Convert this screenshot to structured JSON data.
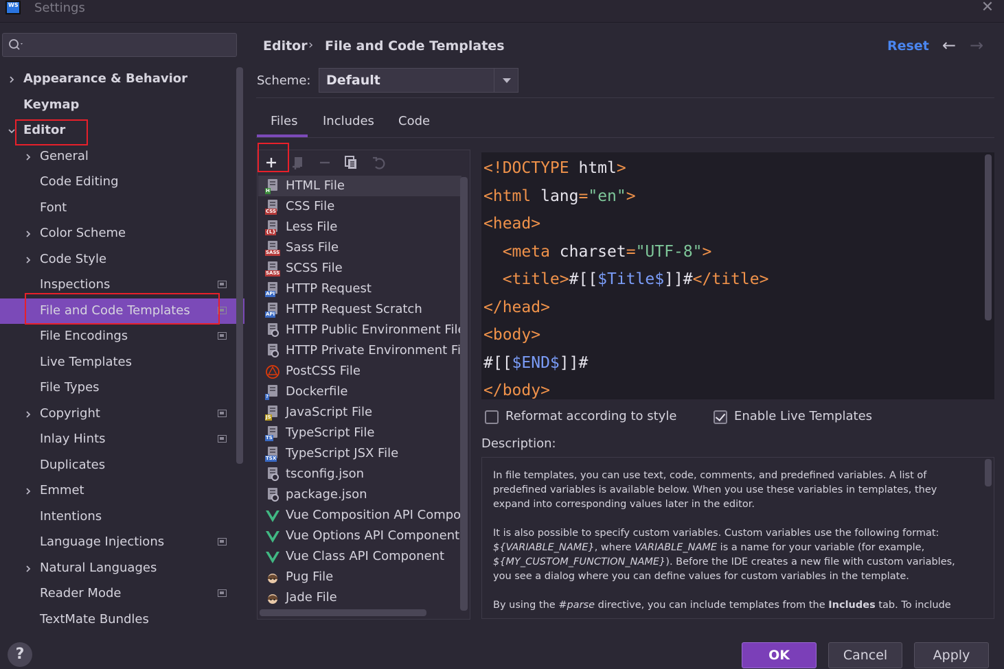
{
  "window": {
    "title": "Settings",
    "logo_text": "WS"
  },
  "search": {
    "placeholder": ""
  },
  "sidebar": {
    "items": [
      {
        "label": "Appearance & Behavior",
        "level": 0,
        "bold": true,
        "expandable": true,
        "expanded": false
      },
      {
        "label": "Keymap",
        "level": 0,
        "bold": true,
        "expandable": false
      },
      {
        "label": "Editor",
        "level": 0,
        "bold": true,
        "expandable": true,
        "expanded": true
      },
      {
        "label": "General",
        "level": 1,
        "expandable": true
      },
      {
        "label": "Code Editing",
        "level": 1
      },
      {
        "label": "Font",
        "level": 1
      },
      {
        "label": "Color Scheme",
        "level": 1,
        "expandable": true
      },
      {
        "label": "Code Style",
        "level": 1,
        "expandable": true
      },
      {
        "label": "Inspections",
        "level": 1,
        "project_level": true
      },
      {
        "label": "File and Code Templates",
        "level": 1,
        "selected": true,
        "project_level": true
      },
      {
        "label": "File Encodings",
        "level": 1,
        "project_level": true
      },
      {
        "label": "Live Templates",
        "level": 1
      },
      {
        "label": "File Types",
        "level": 1
      },
      {
        "label": "Copyright",
        "level": 1,
        "expandable": true,
        "project_level": true
      },
      {
        "label": "Inlay Hints",
        "level": 1,
        "project_level": true
      },
      {
        "label": "Duplicates",
        "level": 1
      },
      {
        "label": "Emmet",
        "level": 1,
        "expandable": true
      },
      {
        "label": "Intentions",
        "level": 1
      },
      {
        "label": "Language Injections",
        "level": 1,
        "project_level": true
      },
      {
        "label": "Natural Languages",
        "level": 1,
        "expandable": true
      },
      {
        "label": "Reader Mode",
        "level": 1,
        "project_level": true
      },
      {
        "label": "TextMate Bundles",
        "level": 1
      }
    ]
  },
  "breadcrumb": {
    "parent": "Editor",
    "separator": "›",
    "current": "File and Code Templates"
  },
  "header": {
    "reset_label": "Reset",
    "back_icon": "arrow-left-icon",
    "forward_icon": "arrow-right-icon"
  },
  "scheme": {
    "label": "Scheme:",
    "value": "Default"
  },
  "tabs": [
    {
      "label": "Files",
      "active": true
    },
    {
      "label": "Includes"
    },
    {
      "label": "Code"
    }
  ],
  "toolbar": {
    "icons": [
      "add-icon",
      "add-child-icon",
      "remove-icon",
      "copy-icon",
      "reset-icon"
    ]
  },
  "templates": [
    {
      "label": "HTML File",
      "icon_tag": "H",
      "tag_color": "#3a8a3a",
      "selected": true
    },
    {
      "label": "CSS File",
      "icon_tag": "CSS",
      "tag_color": "#b53a3a"
    },
    {
      "label": "Less File",
      "icon_tag": "{L}",
      "tag_color": "#b53a3a"
    },
    {
      "label": "Sass File",
      "icon_tag": "SASS",
      "tag_color": "#b53a3a"
    },
    {
      "label": "SCSS File",
      "icon_tag": "SASS",
      "tag_color": "#b53a3a"
    },
    {
      "label": "HTTP Request",
      "icon_tag": "API",
      "tag_color": "#3a6ac4"
    },
    {
      "label": "HTTP Request Scratch",
      "icon_tag": "API",
      "tag_color": "#3a6ac4"
    },
    {
      "label": "HTTP Public Environment File",
      "icon_tag": "cog"
    },
    {
      "label": "HTTP Private Environment File",
      "icon_tag": "cog"
    },
    {
      "label": "PostCSS File",
      "icon_tag": "postcss"
    },
    {
      "label": "Dockerfile",
      "icon_tag": "?",
      "tag_color": "#3a6ac4"
    },
    {
      "label": "JavaScript File",
      "icon_tag": "JS",
      "tag_color": "#b89a20"
    },
    {
      "label": "TypeScript File",
      "icon_tag": "TS",
      "tag_color": "#3a6ac4"
    },
    {
      "label": "TypeScript JSX File",
      "icon_tag": "TSX",
      "tag_color": "#3a6ac4"
    },
    {
      "label": "tsconfig.json",
      "icon_tag": "cog"
    },
    {
      "label": "package.json",
      "icon_tag": "cog"
    },
    {
      "label": "Vue Composition API Component",
      "icon_tag": "vue"
    },
    {
      "label": "Vue Options API Component",
      "icon_tag": "vue"
    },
    {
      "label": "Vue Class API Component",
      "icon_tag": "vue"
    },
    {
      "label": "Pug File",
      "icon_tag": "pug"
    },
    {
      "label": "Jade File",
      "icon_tag": "pug"
    }
  ],
  "editor": {
    "lines": [
      [
        [
          "tag",
          "<!DOCTYPE "
        ],
        [
          "attr",
          "html"
        ],
        [
          "tag",
          ">"
        ]
      ],
      [
        [
          "tag",
          "<html "
        ],
        [
          "attr",
          "lang"
        ],
        [
          "tag",
          "="
        ],
        [
          "val",
          "\"en\""
        ],
        [
          "tag",
          ">"
        ]
      ],
      [
        [
          "tag",
          "<head>"
        ]
      ],
      [
        [
          "tag",
          "  <meta "
        ],
        [
          "attr",
          "charset"
        ],
        [
          "tag",
          "="
        ],
        [
          "val",
          "\"UTF-8\""
        ],
        [
          "tag",
          ">"
        ]
      ],
      [
        [
          "tag",
          "  <title>"
        ],
        [
          "attr",
          "#[["
        ],
        [
          "var",
          "$Title$"
        ],
        [
          "attr",
          "]]#"
        ],
        [
          "tag",
          "</title>"
        ]
      ],
      [
        [
          "tag",
          "</head>"
        ]
      ],
      [
        [
          "tag",
          "<body>"
        ]
      ],
      [
        [
          "attr",
          "#[["
        ],
        [
          "var",
          "$END$"
        ],
        [
          "attr",
          "]]#"
        ]
      ],
      [
        [
          "tag",
          "</body>"
        ]
      ]
    ]
  },
  "options": {
    "reformat_label": "Reformat according to style",
    "reformat_checked": false,
    "live_templates_label": "Enable Live Templates",
    "live_templates_checked": true
  },
  "description": {
    "label": "Description:",
    "paragraphs": [
      [
        [
          "t",
          "In file templates, you can use text, code, comments, and predefined variables. A list of predefined variables is available below. When you use these variables in templates, they expand into corresponding values later in the editor."
        ]
      ],
      [
        [
          "t",
          "It is also possible to specify custom variables. Custom variables use the following format: "
        ],
        [
          "i",
          "${VARIABLE_NAME}"
        ],
        [
          "t",
          ", where "
        ],
        [
          "i",
          "VARIABLE_NAME"
        ],
        [
          "t",
          " is a name for your variable (for example, "
        ],
        [
          "i",
          "${MY_CUSTOM_FUNCTION_NAME}"
        ],
        [
          "t",
          "). Before the IDE creates a new file with custom variables, you see a dialog where you can define values for custom variables in the template."
        ]
      ],
      [
        [
          "t",
          "By using the "
        ],
        [
          "i",
          "#parse"
        ],
        [
          "t",
          " directive, you can include templates from the "
        ],
        [
          "b",
          "Includes"
        ],
        [
          "t",
          " tab. To include "
        ]
      ]
    ]
  },
  "buttons": {
    "help": "?",
    "ok": "OK",
    "cancel": "Cancel",
    "apply": "Apply"
  },
  "colors": {
    "accent": "#7b4ab8",
    "link": "#4a86f0",
    "highlight_box": "#e8202a"
  }
}
